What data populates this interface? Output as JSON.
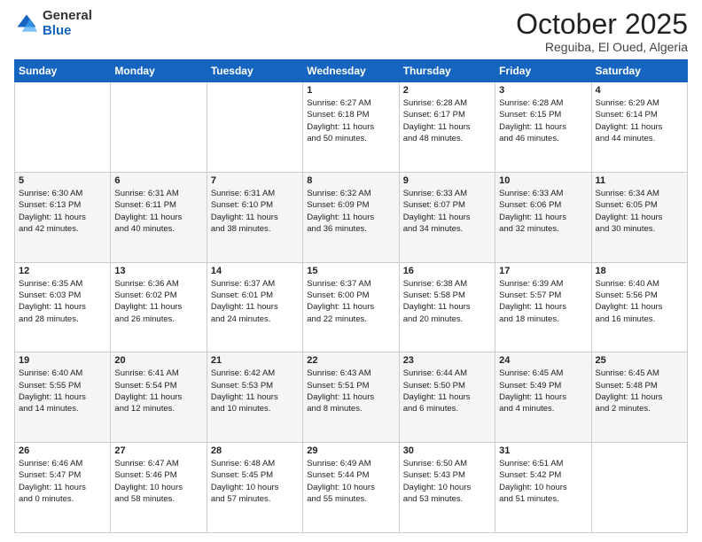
{
  "header": {
    "logo": {
      "general": "General",
      "blue": "Blue"
    },
    "month_title": "October 2025",
    "subtitle": "Reguiba, El Oued, Algeria"
  },
  "weekdays": [
    "Sunday",
    "Monday",
    "Tuesday",
    "Wednesday",
    "Thursday",
    "Friday",
    "Saturday"
  ],
  "weeks": [
    [
      {
        "day": "",
        "info": ""
      },
      {
        "day": "",
        "info": ""
      },
      {
        "day": "",
        "info": ""
      },
      {
        "day": "1",
        "info": "Sunrise: 6:27 AM\nSunset: 6:18 PM\nDaylight: 11 hours\nand 50 minutes."
      },
      {
        "day": "2",
        "info": "Sunrise: 6:28 AM\nSunset: 6:17 PM\nDaylight: 11 hours\nand 48 minutes."
      },
      {
        "day": "3",
        "info": "Sunrise: 6:28 AM\nSunset: 6:15 PM\nDaylight: 11 hours\nand 46 minutes."
      },
      {
        "day": "4",
        "info": "Sunrise: 6:29 AM\nSunset: 6:14 PM\nDaylight: 11 hours\nand 44 minutes."
      }
    ],
    [
      {
        "day": "5",
        "info": "Sunrise: 6:30 AM\nSunset: 6:13 PM\nDaylight: 11 hours\nand 42 minutes."
      },
      {
        "day": "6",
        "info": "Sunrise: 6:31 AM\nSunset: 6:11 PM\nDaylight: 11 hours\nand 40 minutes."
      },
      {
        "day": "7",
        "info": "Sunrise: 6:31 AM\nSunset: 6:10 PM\nDaylight: 11 hours\nand 38 minutes."
      },
      {
        "day": "8",
        "info": "Sunrise: 6:32 AM\nSunset: 6:09 PM\nDaylight: 11 hours\nand 36 minutes."
      },
      {
        "day": "9",
        "info": "Sunrise: 6:33 AM\nSunset: 6:07 PM\nDaylight: 11 hours\nand 34 minutes."
      },
      {
        "day": "10",
        "info": "Sunrise: 6:33 AM\nSunset: 6:06 PM\nDaylight: 11 hours\nand 32 minutes."
      },
      {
        "day": "11",
        "info": "Sunrise: 6:34 AM\nSunset: 6:05 PM\nDaylight: 11 hours\nand 30 minutes."
      }
    ],
    [
      {
        "day": "12",
        "info": "Sunrise: 6:35 AM\nSunset: 6:03 PM\nDaylight: 11 hours\nand 28 minutes."
      },
      {
        "day": "13",
        "info": "Sunrise: 6:36 AM\nSunset: 6:02 PM\nDaylight: 11 hours\nand 26 minutes."
      },
      {
        "day": "14",
        "info": "Sunrise: 6:37 AM\nSunset: 6:01 PM\nDaylight: 11 hours\nand 24 minutes."
      },
      {
        "day": "15",
        "info": "Sunrise: 6:37 AM\nSunset: 6:00 PM\nDaylight: 11 hours\nand 22 minutes."
      },
      {
        "day": "16",
        "info": "Sunrise: 6:38 AM\nSunset: 5:58 PM\nDaylight: 11 hours\nand 20 minutes."
      },
      {
        "day": "17",
        "info": "Sunrise: 6:39 AM\nSunset: 5:57 PM\nDaylight: 11 hours\nand 18 minutes."
      },
      {
        "day": "18",
        "info": "Sunrise: 6:40 AM\nSunset: 5:56 PM\nDaylight: 11 hours\nand 16 minutes."
      }
    ],
    [
      {
        "day": "19",
        "info": "Sunrise: 6:40 AM\nSunset: 5:55 PM\nDaylight: 11 hours\nand 14 minutes."
      },
      {
        "day": "20",
        "info": "Sunrise: 6:41 AM\nSunset: 5:54 PM\nDaylight: 11 hours\nand 12 minutes."
      },
      {
        "day": "21",
        "info": "Sunrise: 6:42 AM\nSunset: 5:53 PM\nDaylight: 11 hours\nand 10 minutes."
      },
      {
        "day": "22",
        "info": "Sunrise: 6:43 AM\nSunset: 5:51 PM\nDaylight: 11 hours\nand 8 minutes."
      },
      {
        "day": "23",
        "info": "Sunrise: 6:44 AM\nSunset: 5:50 PM\nDaylight: 11 hours\nand 6 minutes."
      },
      {
        "day": "24",
        "info": "Sunrise: 6:45 AM\nSunset: 5:49 PM\nDaylight: 11 hours\nand 4 minutes."
      },
      {
        "day": "25",
        "info": "Sunrise: 6:45 AM\nSunset: 5:48 PM\nDaylight: 11 hours\nand 2 minutes."
      }
    ],
    [
      {
        "day": "26",
        "info": "Sunrise: 6:46 AM\nSunset: 5:47 PM\nDaylight: 11 hours\nand 0 minutes."
      },
      {
        "day": "27",
        "info": "Sunrise: 6:47 AM\nSunset: 5:46 PM\nDaylight: 10 hours\nand 58 minutes."
      },
      {
        "day": "28",
        "info": "Sunrise: 6:48 AM\nSunset: 5:45 PM\nDaylight: 10 hours\nand 57 minutes."
      },
      {
        "day": "29",
        "info": "Sunrise: 6:49 AM\nSunset: 5:44 PM\nDaylight: 10 hours\nand 55 minutes."
      },
      {
        "day": "30",
        "info": "Sunrise: 6:50 AM\nSunset: 5:43 PM\nDaylight: 10 hours\nand 53 minutes."
      },
      {
        "day": "31",
        "info": "Sunrise: 6:51 AM\nSunset: 5:42 PM\nDaylight: 10 hours\nand 51 minutes."
      },
      {
        "day": "",
        "info": ""
      }
    ]
  ]
}
